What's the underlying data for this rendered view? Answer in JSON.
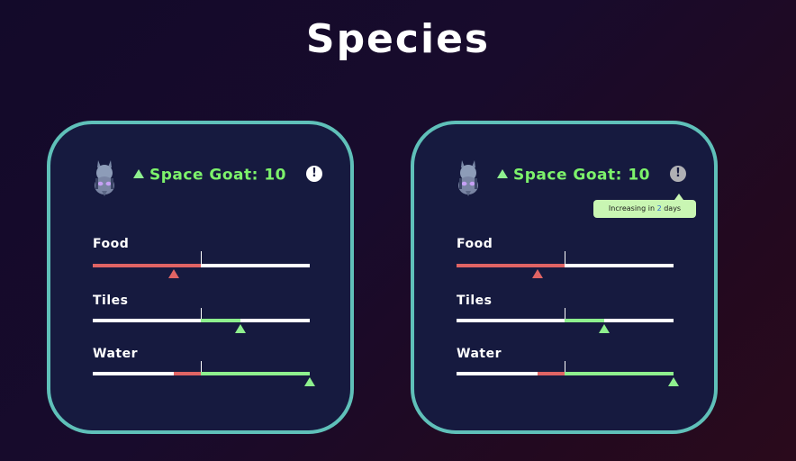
{
  "page": {
    "title": "Species"
  },
  "cards": [
    {
      "species": {
        "name": "Space Goat: 10",
        "trend": "up"
      },
      "info_icon": "exclamation-icon",
      "tooltip": null,
      "stats": [
        {
          "label": "Food",
          "balance": -0.75,
          "marker": -0.25,
          "marker_color": "#e06464"
        },
        {
          "label": "Tiles",
          "balance": 0.37,
          "marker": 0.37,
          "marker_color": "#8ef08e"
        },
        {
          "label": "Water",
          "deficit": -0.25,
          "surplus": 1.0,
          "marker": 1.0,
          "marker_color": "#8ef08e"
        }
      ]
    },
    {
      "species": {
        "name": "Space Goat: 10",
        "trend": "up"
      },
      "info_icon": "exclamation-icon",
      "tooltip": {
        "prefix": "Increasing in ",
        "number": "2",
        "suffix": " days"
      },
      "stats": [
        {
          "label": "Food",
          "balance": -0.75,
          "marker": -0.25,
          "marker_color": "#e06464"
        },
        {
          "label": "Tiles",
          "balance": 0.37,
          "marker": 0.37,
          "marker_color": "#8ef08e"
        },
        {
          "label": "Water",
          "deficit": -0.25,
          "surplus": 1.0,
          "marker": 1.0,
          "marker_color": "#8ef08e"
        }
      ]
    }
  ],
  "colors": {
    "accent": "#5fc0b9",
    "positive": "#8ef08e",
    "negative": "#e06464",
    "species_text": "#7df26b",
    "card_bg": "#161a3f"
  }
}
